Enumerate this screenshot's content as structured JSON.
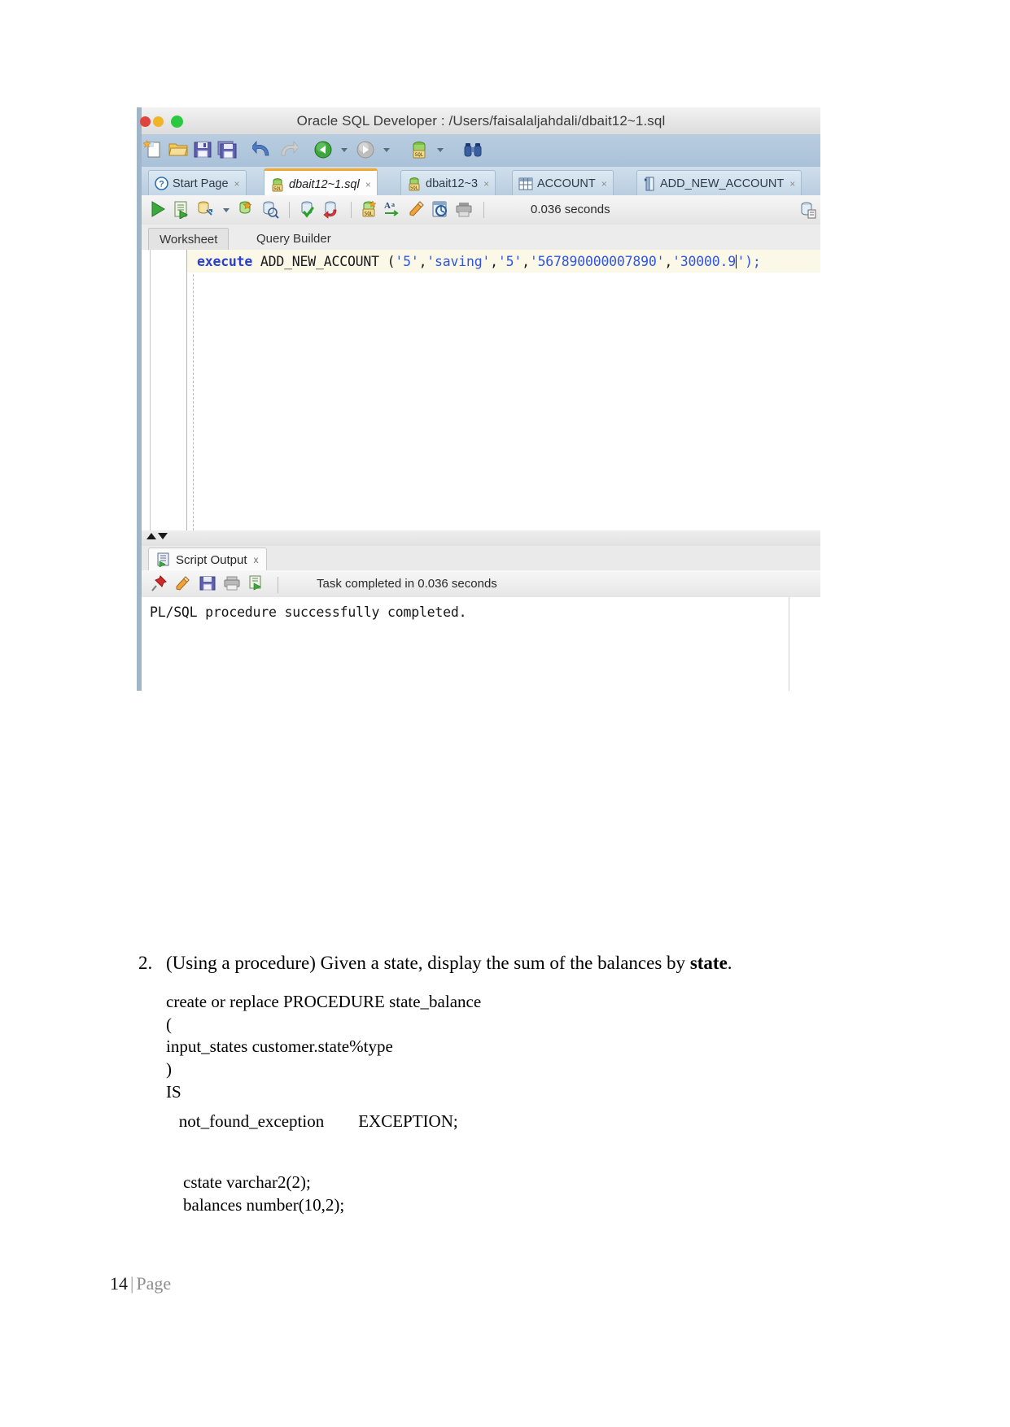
{
  "figure": {
    "window_title": "Oracle SQL Developer : /Users/faisalaljahdali/dbait12~1.sql",
    "traffic_lights": [
      "close",
      "minimize",
      "zoom"
    ],
    "main_toolbar_icons": [
      "new-file-icon",
      "open-folder-icon",
      "save-icon",
      "save-all-icon",
      "undo-icon",
      "redo-icon",
      "navigate-back-icon",
      "navigate-forward-icon",
      "run-sql-icon",
      "find-binoculars-icon"
    ],
    "document_tabs": [
      {
        "label": "Start Page",
        "icon": "help-question-icon",
        "active": false,
        "closable": true
      },
      {
        "label": "dbait12~1.sql",
        "icon": "sql-worksheet-icon",
        "active": true,
        "closable": true
      },
      {
        "label": "dbait12~3",
        "icon": "sql-worksheet-icon",
        "active": false,
        "closable": true
      },
      {
        "label": "ACCOUNT",
        "icon": "table-grid-icon",
        "active": false,
        "closable": true
      },
      {
        "label": "ADD_NEW_ACCOUNT",
        "icon": "procedure-icon",
        "active": false,
        "closable": true
      }
    ],
    "worksheet_toolbar": {
      "icons": [
        "run-statement-icon",
        "run-script-icon",
        "explain-plan-icon",
        "dropdown-caret-icon",
        "autotrace-icon",
        "sql-history-icon",
        "commit-icon",
        "rollback-icon",
        "unshared-worksheet-icon",
        "format-sql-icon",
        "clear-icon",
        "query-builder-icon",
        "print-icon"
      ],
      "timing": "0.036 seconds",
      "right_icon": "open-sql-worksheet-icon"
    },
    "sub_tabs": [
      {
        "label": "Worksheet",
        "selected": true
      },
      {
        "label": "Query Builder",
        "selected": false
      }
    ],
    "editor": {
      "code_tokens": [
        {
          "text": "execute",
          "type": "keyword"
        },
        {
          "text": " ADD_NEW_ACCOUNT ",
          "type": "identifier"
        },
        {
          "text": "(",
          "type": "identifier"
        },
        {
          "text": "'5'",
          "type": "string"
        },
        {
          "text": ",",
          "type": "identifier"
        },
        {
          "text": "'saving'",
          "type": "string"
        },
        {
          "text": ",",
          "type": "identifier"
        },
        {
          "text": "'5'",
          "type": "string"
        },
        {
          "text": ",",
          "type": "identifier"
        },
        {
          "text": "'567890000007890'",
          "type": "string"
        },
        {
          "text": ",",
          "type": "identifier"
        },
        {
          "text": "'30000.9",
          "type": "string"
        }
      ],
      "code_tail": "');",
      "full_line": "execute ADD_NEW_ACCOUNT ('5','saving','5','567890000007890','30000.9');"
    },
    "script_output": {
      "tab_label": "Script Output",
      "tab_icon": "script-output-icon",
      "tab_close": "x",
      "toolbar_icons": [
        "pin-icon",
        "clear-icon",
        "save-icon",
        "print-icon",
        "run-script-icon"
      ],
      "status": "Task completed in 0.036 seconds",
      "body_text": "PL/SQL procedure successfully completed."
    }
  },
  "document": {
    "question": {
      "number": "2.",
      "prefix": "(Using a procedure) Given a state, display the sum of the balances by ",
      "bold": "state",
      "suffix": "."
    },
    "code_block_1": "create or replace PROCEDURE state_balance\n(\ninput_states customer.state%type\n)\nIS",
    "code_block_2": "   not_found_exception        EXCEPTION;",
    "code_block_3": "    cstate varchar2(2);\n    balances number(10,2);",
    "footer": {
      "page_number": "14",
      "separator": "|",
      "label": "Page"
    }
  }
}
